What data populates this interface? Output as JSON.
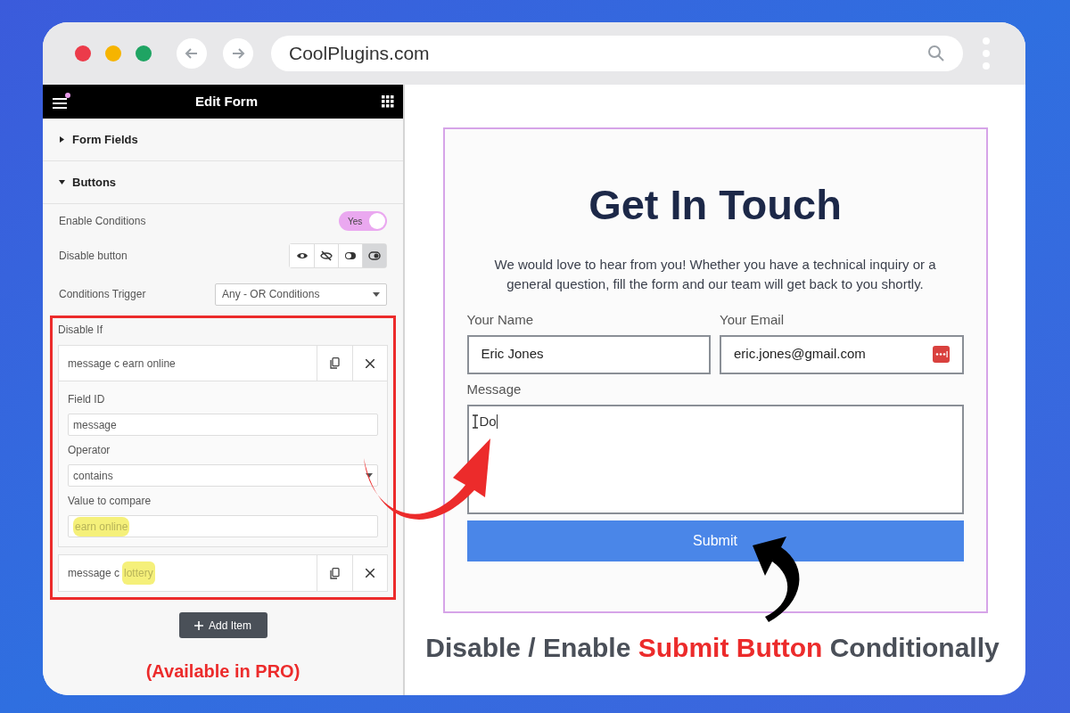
{
  "browser": {
    "url": "CoolPlugins.com"
  },
  "editor": {
    "title": "Edit Form",
    "sections": [
      {
        "label": "Form Fields",
        "expanded": false
      },
      {
        "label": "Buttons",
        "expanded": true
      }
    ],
    "enable_conditions": {
      "label": "Enable Conditions",
      "on": true,
      "text": "Yes"
    },
    "disable_button": {
      "label": "Disable button",
      "options": [
        {
          "kind": "eye",
          "selected": false
        },
        {
          "kind": "eye-slash",
          "selected": false
        },
        {
          "kind": "toggle-left",
          "selected": false
        },
        {
          "kind": "toggle-right",
          "selected": true
        }
      ]
    },
    "conditions_trigger": {
      "label": "Conditions Trigger",
      "value": "Any - OR Conditions"
    },
    "disable_if": {
      "label": "Disable If",
      "items": [
        {
          "title": "message c earn online",
          "expanded": true,
          "fields": [
            {
              "kind": "text",
              "label": "Field ID",
              "value": "message",
              "highlighted": false
            },
            {
              "kind": "select",
              "label": "Operator",
              "value": "contains",
              "highlighted": false
            },
            {
              "kind": "text",
              "label": "Value to compare",
              "value": "earn online",
              "highlighted": true
            }
          ]
        },
        {
          "title": "message c",
          "highlight": "lottery",
          "expanded": false
        }
      ]
    },
    "add_button": "Add Item",
    "pro_note": "(Available in PRO)"
  },
  "form": {
    "heading": "Get In Touch",
    "intro": "We would love to hear from you! Whether you have a technical inquiry or a general question, fill the form and our team will get back to you shortly.",
    "fields": [
      {
        "label": "Your Name",
        "value": "Eric Jones",
        "password_icon": false
      },
      {
        "label": "Your Email",
        "value": "eric.jones@gmail.com",
        "password_icon": true
      }
    ],
    "message": {
      "label": "Message",
      "value": "Do"
    },
    "submit": "Submit"
  },
  "caption": {
    "before": "Disable / Enable",
    "highlight": "Submit Button",
    "after": "Conditionally"
  }
}
